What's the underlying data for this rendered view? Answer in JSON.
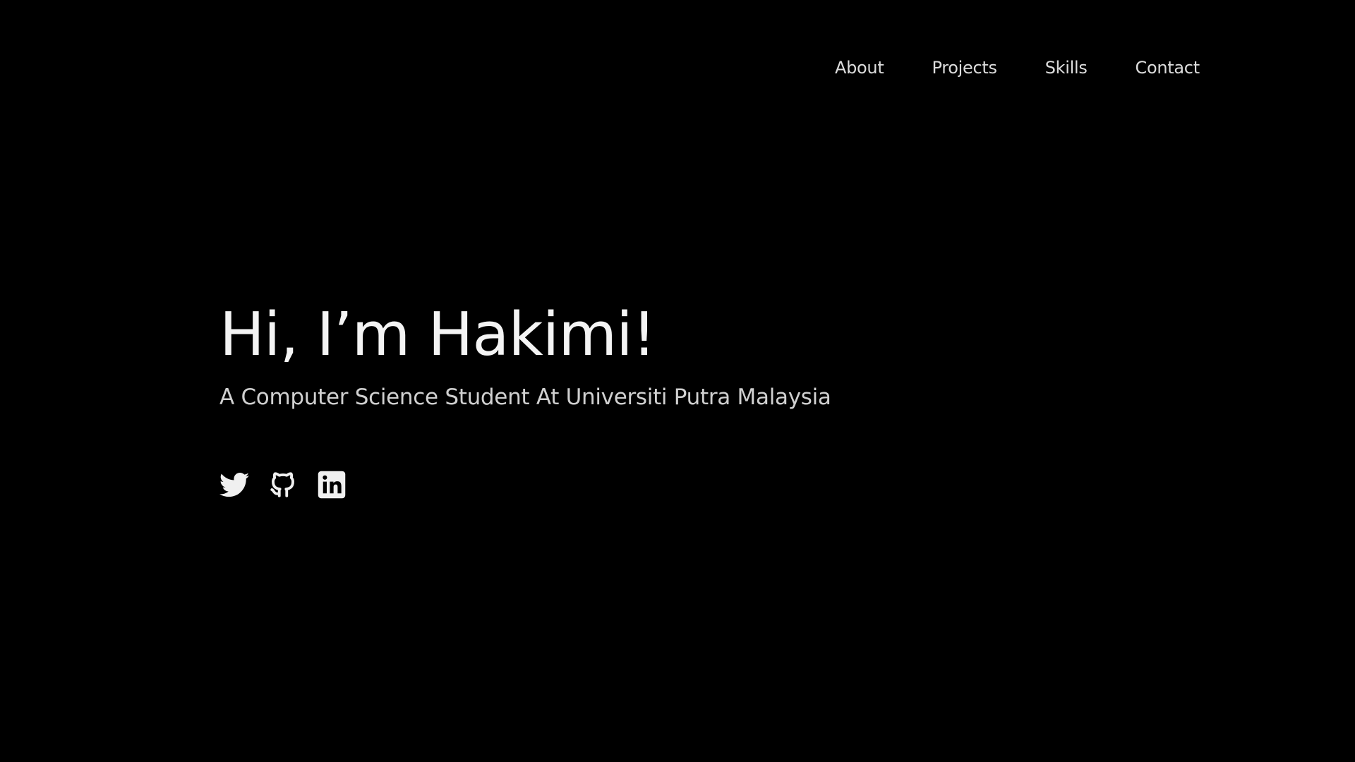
{
  "nav": {
    "items": [
      {
        "label": "About"
      },
      {
        "label": "Projects"
      },
      {
        "label": "Skills"
      },
      {
        "label": "Contact"
      }
    ]
  },
  "hero": {
    "title": "Hi, I’m Hakimi!",
    "subtitle": "A Computer Science Student At Universiti Putra Malaysia"
  },
  "socials": [
    {
      "icon": "twitter-icon"
    },
    {
      "icon": "github-icon"
    },
    {
      "icon": "linkedin-icon"
    }
  ],
  "colors": {
    "background": "#000000",
    "text": "#f2f2f2",
    "nav_text": "#dcdcdc",
    "subtitle": "#d0d0d0"
  }
}
